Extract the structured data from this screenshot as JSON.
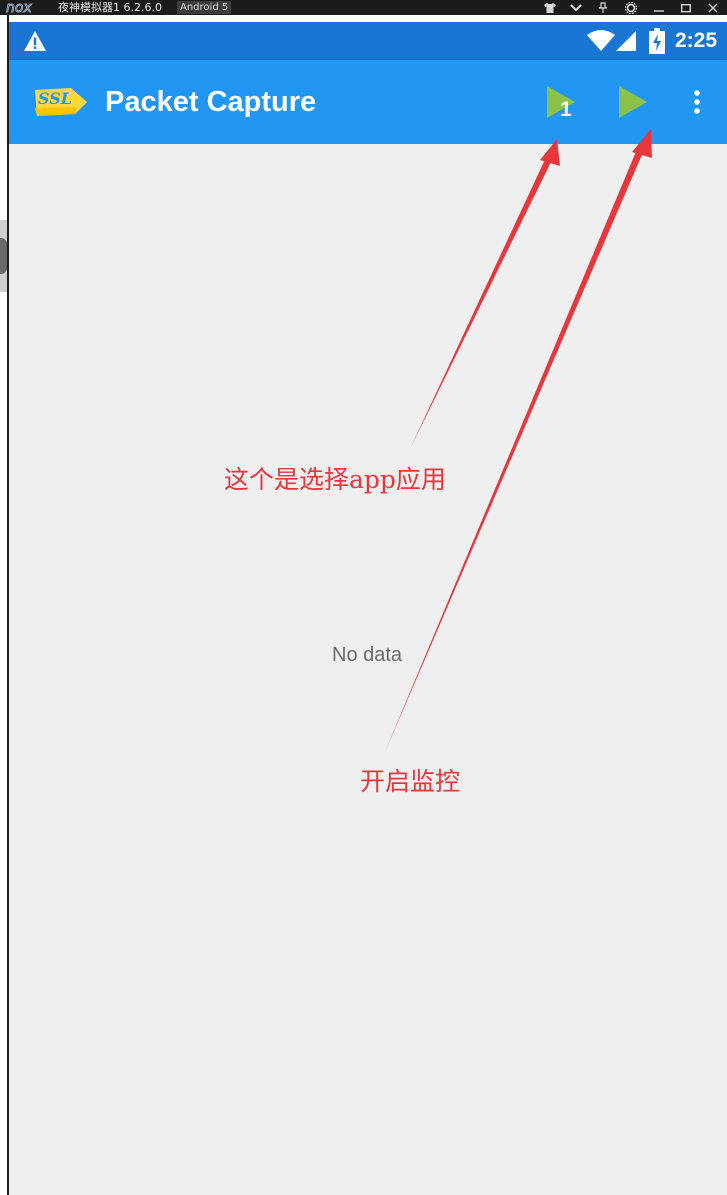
{
  "emulator": {
    "logo_text": "nox",
    "title": "夜神模拟器1 6.2.6.0",
    "version_badge": "Android 5",
    "controls": [
      "shirt-icon",
      "chevron-down-icon",
      "pin-icon",
      "gear-icon",
      "minimize-icon",
      "maximize-icon",
      "close-icon"
    ]
  },
  "status_bar": {
    "time": "2:25",
    "icons": [
      "warning-icon",
      "wifi-icon",
      "signal-icon",
      "battery-charging-icon"
    ]
  },
  "app_bar": {
    "title": "Packet Capture",
    "select_app_badge": "1",
    "colors": {
      "app_bar": "#2196f3",
      "status_bar": "#1976d2",
      "play_icon": "#8bc34a"
    }
  },
  "content": {
    "empty_text": "No data"
  },
  "annotations": {
    "select_app": "这个是选择app应用",
    "start_capture": "开启监控",
    "color": "#e8363d"
  }
}
